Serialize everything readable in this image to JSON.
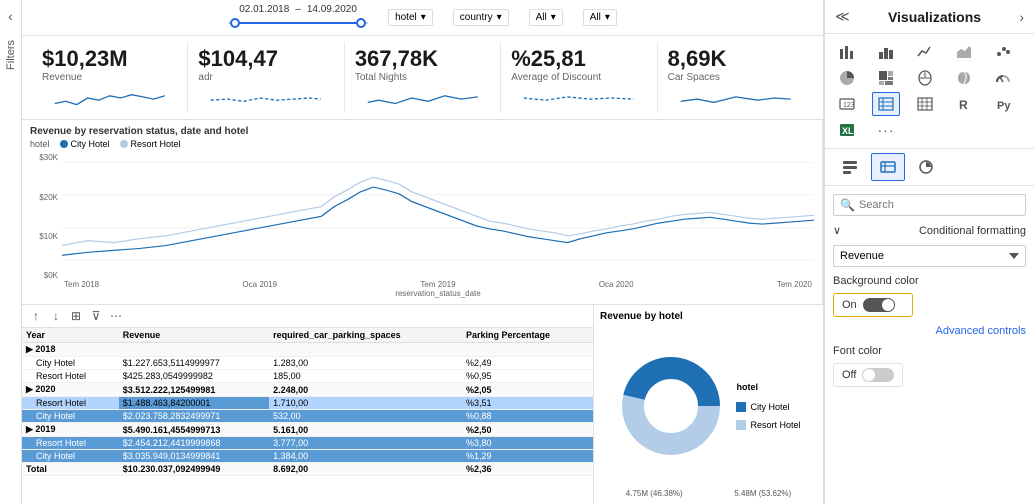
{
  "filter_bar": {
    "date_from": "02.01.2018",
    "date_to": "14.09.2020",
    "hotel_label": "hotel",
    "country_label": "country",
    "all1": "All",
    "all2": "All"
  },
  "kpis": [
    {
      "value": "$10,23M",
      "label": "Revenue"
    },
    {
      "value": "$104,47",
      "label": "adr"
    },
    {
      "value": "367,78K",
      "label": "Total Nights"
    },
    {
      "value": "%25,81",
      "label": "Average of Discount"
    },
    {
      "value": "8,69K",
      "label": "Car Spaces"
    }
  ],
  "line_chart": {
    "title": "Revenue by reservation status, date and hotel",
    "hotel_label": "hotel",
    "legend": [
      {
        "label": "City Hotel",
        "color": "#1f6fb5"
      },
      {
        "label": "Resort Hotel",
        "color": "#b3cce8"
      }
    ],
    "y_labels": [
      "$30K",
      "$20K",
      "$10K",
      "$0K"
    ],
    "x_labels": [
      "Tem 2018",
      "Oca 2019",
      "Tem 2019",
      "Oca 2020",
      "Tem 2020"
    ],
    "x_axis_label": "reservation_status_date"
  },
  "table": {
    "columns": [
      "Year",
      "Revenue",
      "required_car_parking_spaces",
      "Parking Percentage"
    ],
    "rows": [
      {
        "year": "2018",
        "revenue": "",
        "parking": "",
        "pct": "",
        "is_group": true
      },
      {
        "year": "City Hotel",
        "revenue": "$1.227.653,5114999977",
        "parking": "1.283,00",
        "pct": "%2,49",
        "indent": true
      },
      {
        "year": "Resort Hotel",
        "revenue": "$425.283,0549999982",
        "parking": "185,00",
        "pct": "%0,95",
        "indent": true
      },
      {
        "year": "2020",
        "revenue": "$3.512.222,125499981",
        "parking": "2.248,00",
        "pct": "%2,05",
        "is_group": true
      },
      {
        "year": "Resort Hotel",
        "revenue": "$1.488.463,84200001",
        "parking": "1.710,00",
        "pct": "%3,51",
        "indent": true,
        "selected": true
      },
      {
        "year": "City Hotel",
        "revenue": "$2.023.758,2832499971",
        "parking": "532,00",
        "pct": "%0,88",
        "indent": true,
        "selected2": true
      },
      {
        "year": "2019",
        "revenue": "$5.490.161,4554999713",
        "parking": "5.161,00",
        "pct": "%2,50",
        "is_group": true
      },
      {
        "year": "Resort Hotel",
        "revenue": "$2.454.212,4419999868",
        "parking": "3.777,00",
        "pct": "%3,80",
        "indent": true,
        "selected2": true
      },
      {
        "year": "City Hotel",
        "revenue": "$3.035.949,0134999841",
        "parking": "1.384,00",
        "pct": "%1,29",
        "indent": true,
        "selected2": true
      },
      {
        "year": "Total",
        "revenue": "$10.230.037,092499949",
        "parking": "8.692,00",
        "pct": "%2,36",
        "is_group": true
      }
    ]
  },
  "donut_chart": {
    "title": "Revenue by hotel",
    "segments": [
      {
        "label": "City Hotel",
        "value": 46.38,
        "color": "#1f6fb5",
        "display": "4.75M (46.38%)"
      },
      {
        "label": "Resort Hotel",
        "value": 53.62,
        "color": "#b3cce8",
        "display": "5.48M (53.62%)"
      }
    ]
  },
  "visualizations_panel": {
    "title": "Visualizations",
    "search_placeholder": "Search",
    "conditional_formatting_label": "Conditional formatting",
    "field_dropdown": "Revenue",
    "background_color_label": "Background color",
    "toggle_on_label": "On",
    "advanced_controls_label": "Advanced controls",
    "font_color_label": "Font color",
    "toggle_off_label": "Off"
  },
  "filters_sidebar": {
    "label": "Filters"
  }
}
